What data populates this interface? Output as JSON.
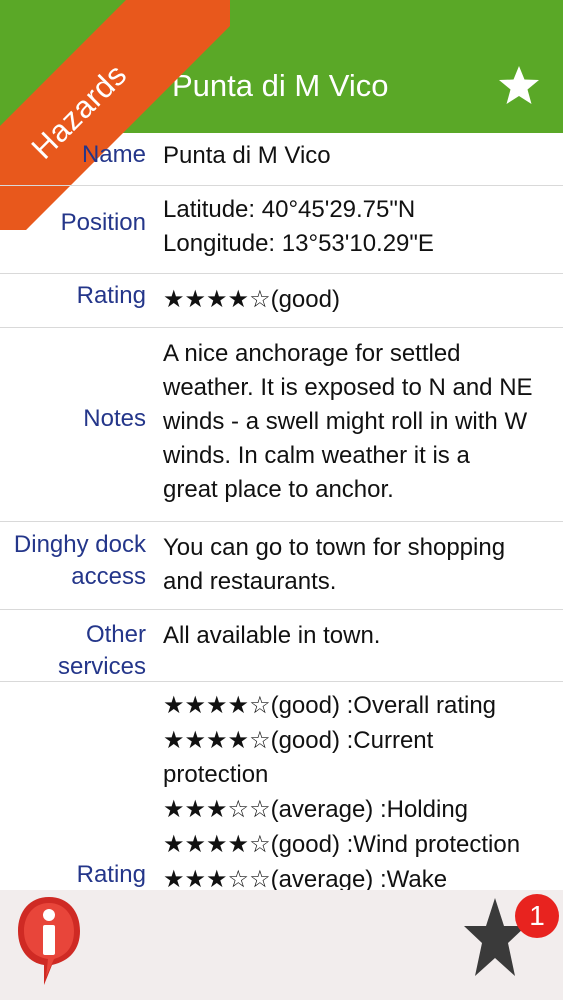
{
  "header": {
    "title": "Punta di M Vico",
    "ribbon": "Hazards",
    "favorite_icon": "star-icon"
  },
  "details": {
    "name_label": "Name",
    "name_value": "Punta di M Vico",
    "position_label": "Position",
    "latitude": "Latitude: 40°45'29.75\"N",
    "longitude": "Longitude: 13°53'10.29\"E",
    "rating_label": "Rating",
    "rating_value": "★★★★☆(good)",
    "notes_label": "Notes",
    "notes_lines": [
      "A nice anchorage for settled",
      "weather.  It is exposed to N and NE",
      "winds - a swell might roll in with W",
      "winds.  In calm weather it is a",
      "great place to anchor."
    ],
    "dinghy_label_1": "Dinghy dock",
    "dinghy_label_2": "access",
    "dinghy_lines": [
      "You can go to town for shopping",
      "and restaurants."
    ],
    "services_label_1": "Other",
    "services_label_2": "services",
    "services_value": "All available in town.",
    "ratings_label": "Rating",
    "ratings_lines": [
      "★★★★☆(good) :Overall rating",
      "★★★★☆(good) :Current",
      "protection",
      "★★★☆☆(average) :Holding",
      "★★★★☆(good) :Wind protection",
      "★★★☆☆(average) :Wake"
    ]
  },
  "footer": {
    "info_icon": "info-icon",
    "favorites_icon": "star-icon",
    "favorites_badge": "1"
  },
  "colors": {
    "header": "#5aa827",
    "ribbon": "#e8581c",
    "label": "#24368a",
    "badge": "#e8231f"
  }
}
